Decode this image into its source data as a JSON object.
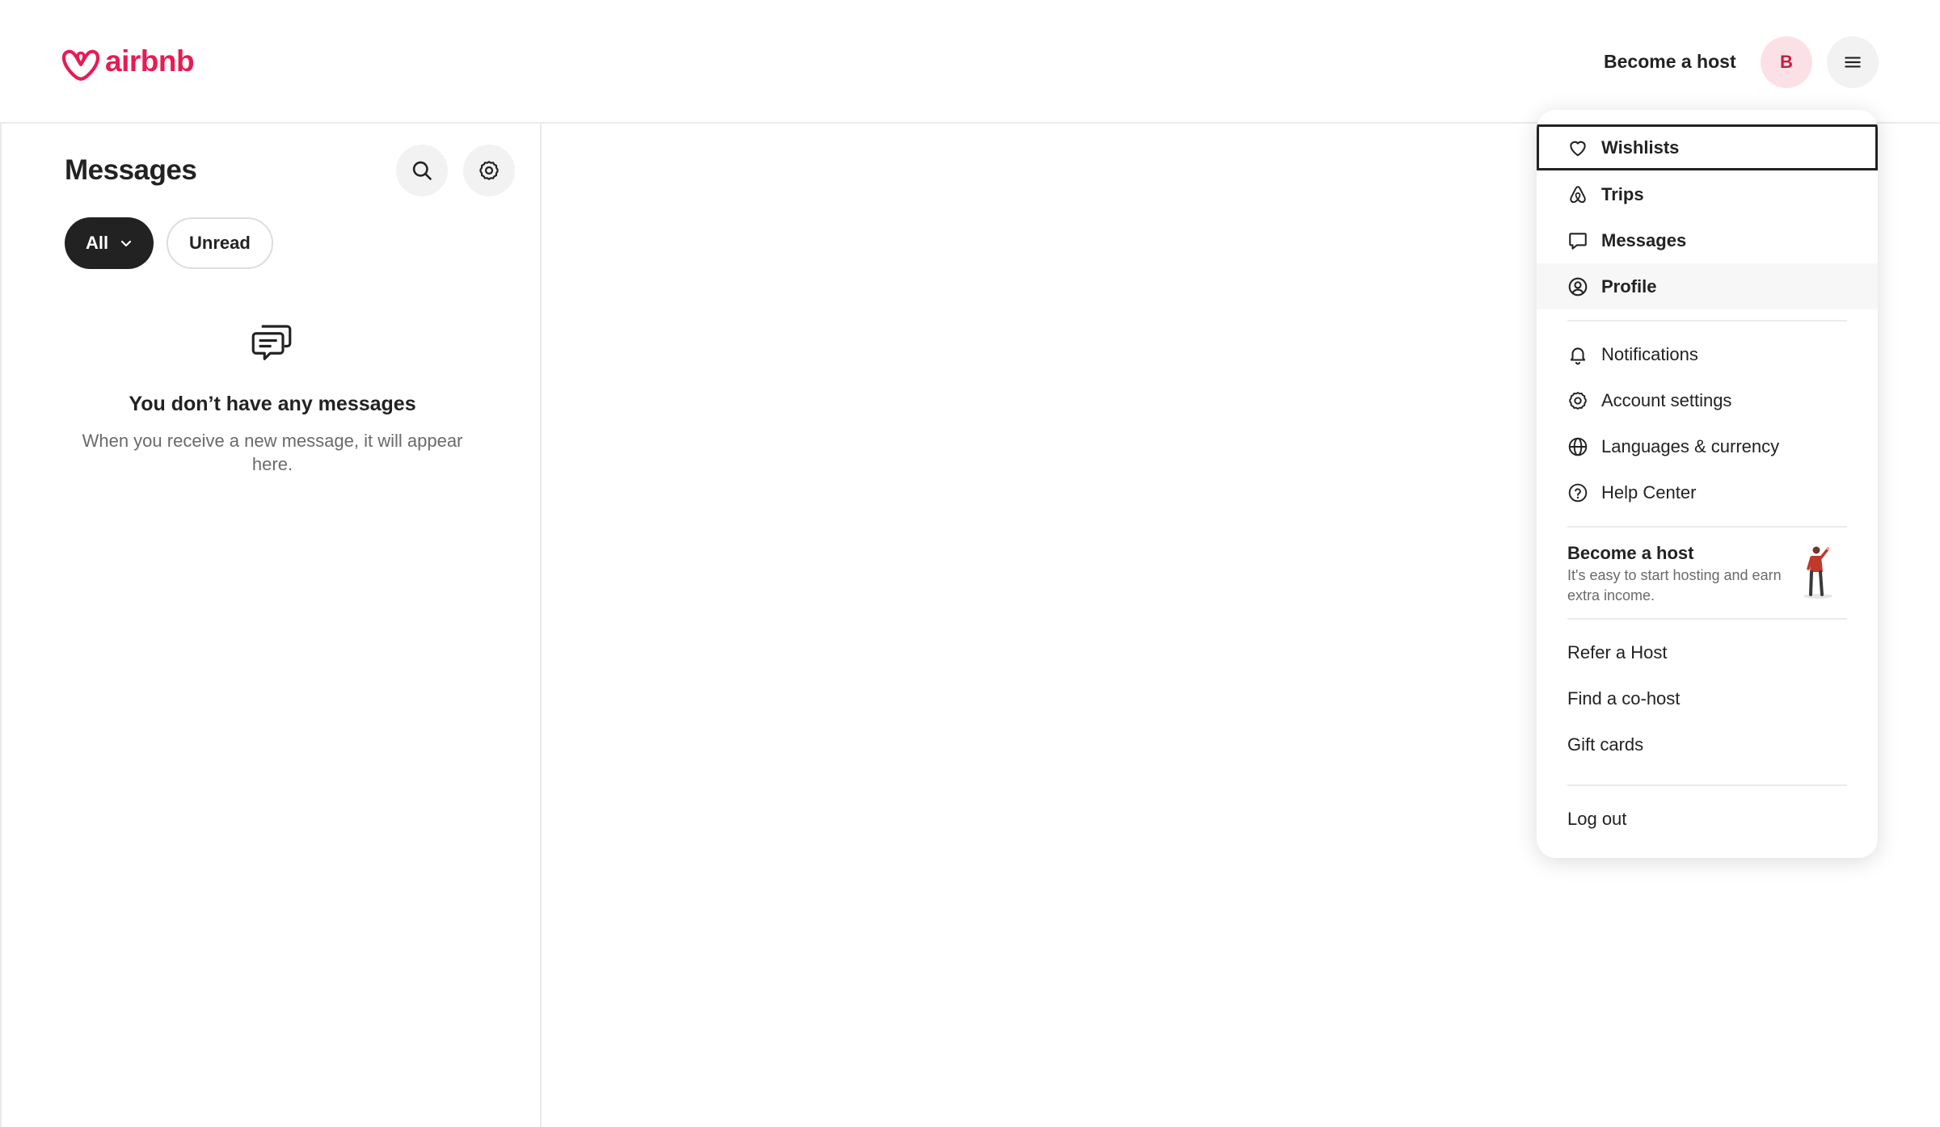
{
  "header": {
    "logo_text": "airbnb",
    "become_host": "Become a host",
    "avatar_initial": "B"
  },
  "messages": {
    "title": "Messages",
    "filters": {
      "all": "All",
      "unread": "Unread"
    },
    "empty_title": "You don’t have any messages",
    "empty_description": "When you receive a new message, it will appear here."
  },
  "menu": {
    "wishlists": "Wishlists",
    "trips": "Trips",
    "messages": "Messages",
    "profile": "Profile",
    "notifications": "Notifications",
    "account_settings": "Account settings",
    "languages_currency": "Languages & currency",
    "help_center": "Help Center",
    "host_promo": {
      "title": "Become a host",
      "description": "It's easy to start hosting and earn extra income."
    },
    "refer_host": "Refer a Host",
    "find_cohost": "Find a co-host",
    "gift_cards": "Gift cards",
    "log_out": "Log out"
  },
  "colors": {
    "brand": "#e51d53",
    "text": "#222222",
    "muted": "#6a6a6a",
    "avatar_bg": "#fbe1e5"
  }
}
